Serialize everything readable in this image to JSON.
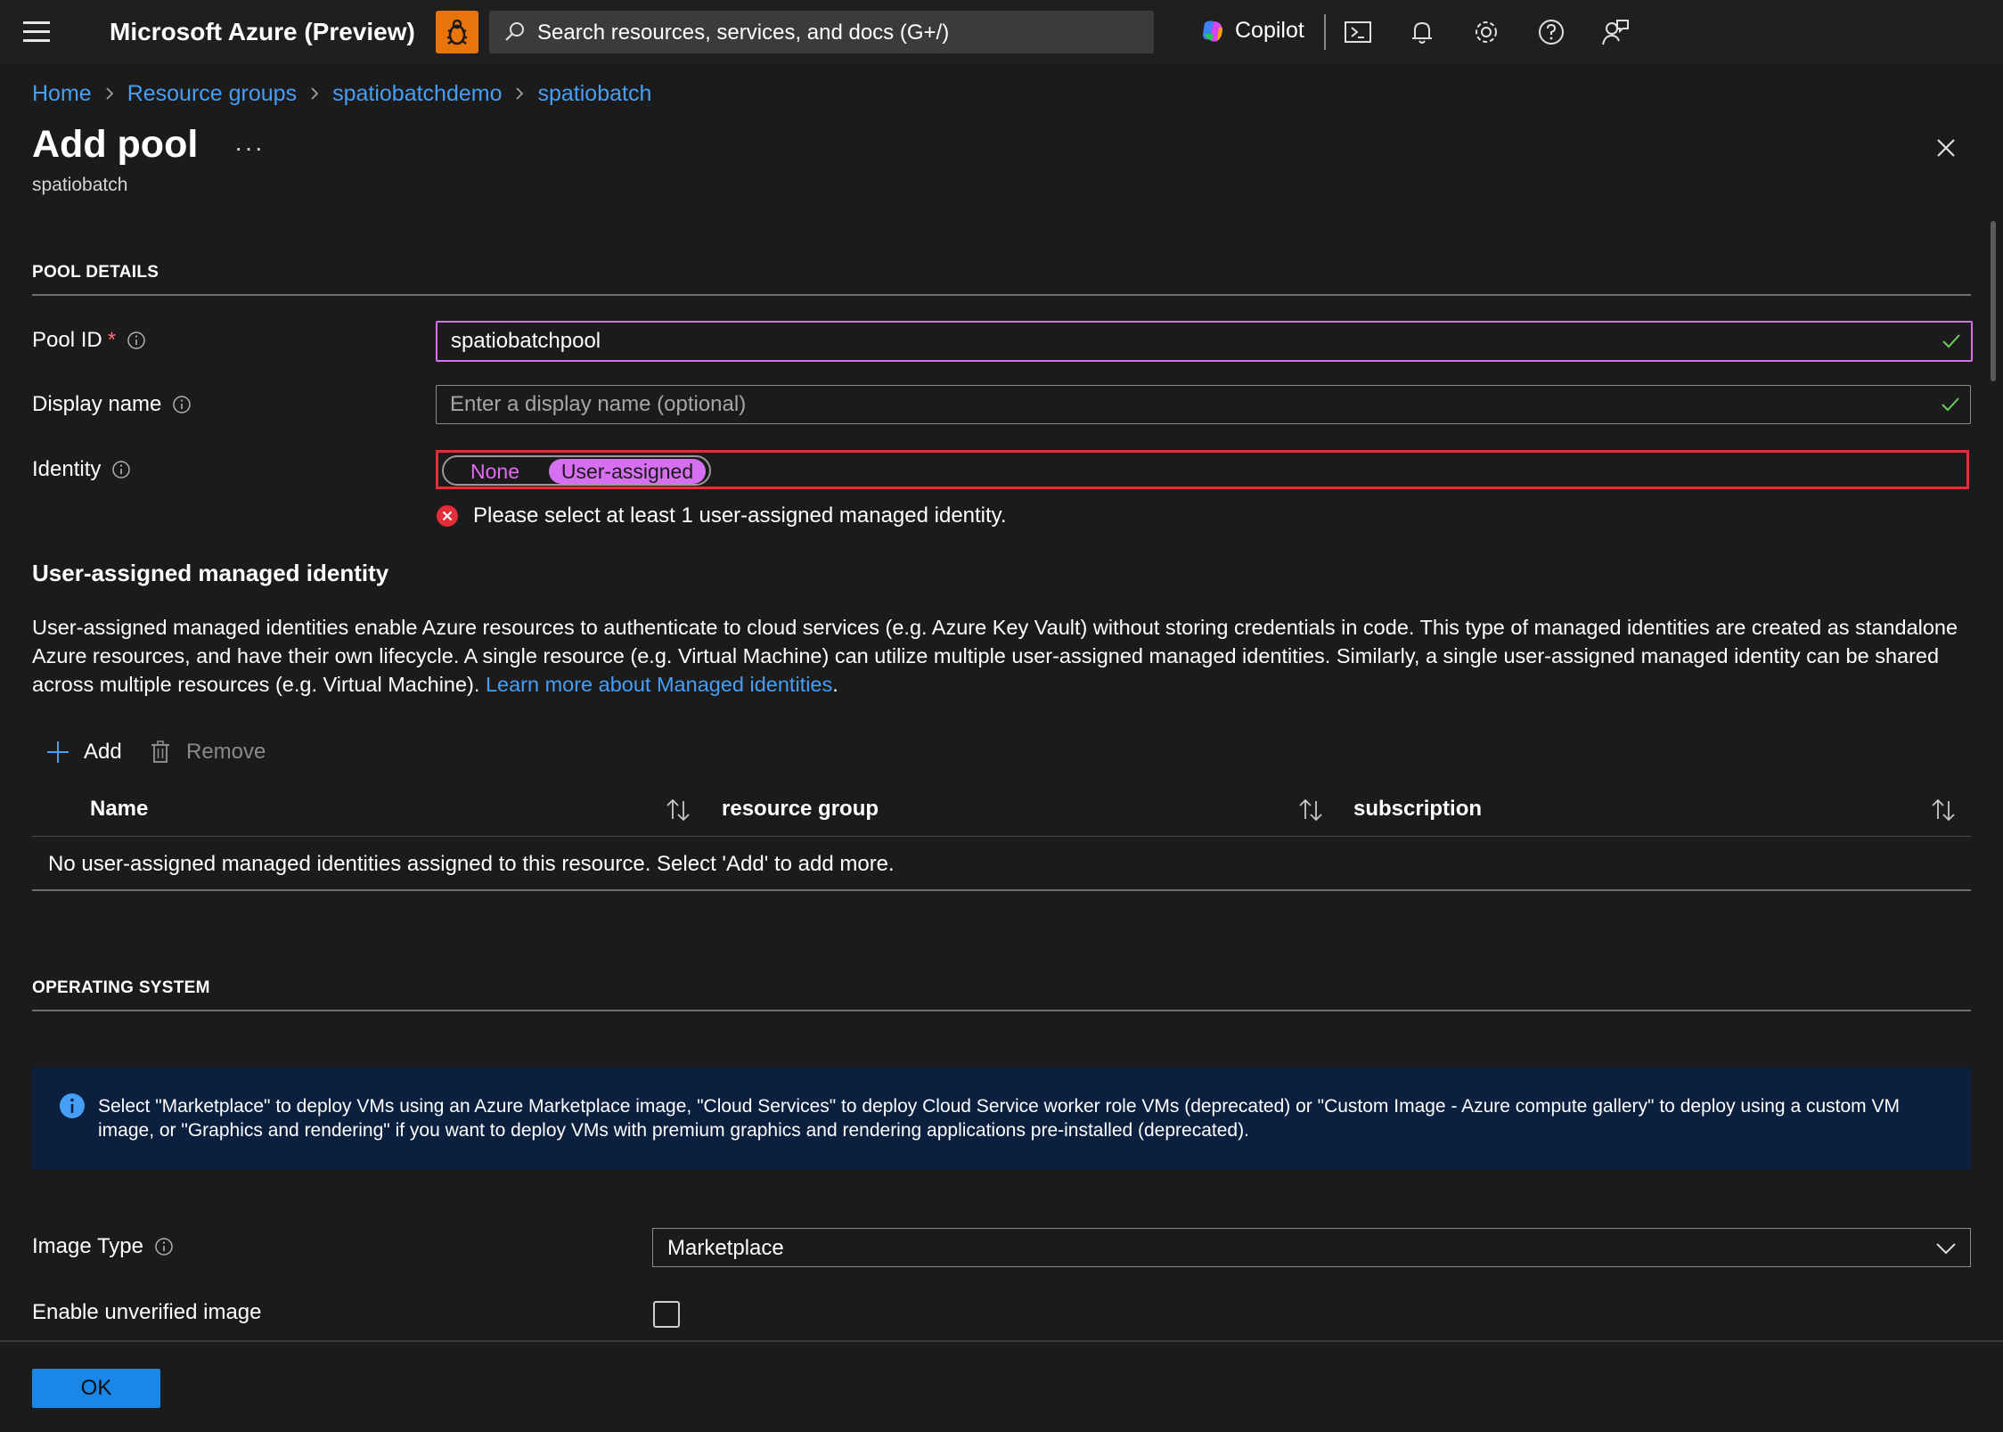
{
  "topbar": {
    "brand": "Microsoft Azure (Preview)",
    "search_placeholder": "Search resources, services, and docs (G+/)",
    "copilot_label": "Copilot"
  },
  "breadcrumb": [
    "Home",
    "Resource groups",
    "spatiobatchdemo",
    "spatiobatch"
  ],
  "header": {
    "title": "Add pool",
    "more": "···",
    "subtitle": "spatiobatch"
  },
  "pool_details": {
    "section_title": "POOL DETAILS",
    "pool_id_label": "Pool ID",
    "pool_id_required": "*",
    "pool_id_value": "spatiobatchpool",
    "display_name_label": "Display name",
    "display_name_placeholder": "Enter a display name (optional)",
    "identity_label": "Identity",
    "identity_options": [
      "None",
      "User-assigned"
    ],
    "identity_selected": "User-assigned",
    "identity_error": "Please select at least 1 user-assigned managed identity."
  },
  "managed_identity": {
    "title": "User-assigned managed identity",
    "description": "User-assigned managed identities enable Azure resources to authenticate to cloud services (e.g. Azure Key Vault) without storing credentials in code. This type of managed identities are created as standalone Azure resources, and have their own lifecycle. A single resource (e.g. Virtual Machine) can utilize multiple user-assigned managed identities. Similarly, a single user-assigned managed identity can be shared across multiple resources (e.g. Virtual Machine). ",
    "learn_more": "Learn more about Managed identities",
    "period": ".",
    "add_label": "Add",
    "remove_label": "Remove",
    "columns": [
      "Name",
      "resource group",
      "subscription"
    ],
    "empty_message": "No user-assigned managed identities assigned to this resource. Select 'Add' to add more."
  },
  "operating_system": {
    "section_title": "OPERATING SYSTEM",
    "info": "Select \"Marketplace\" to deploy VMs using an Azure Marketplace image, \"Cloud Services\" to deploy Cloud Service worker role VMs (deprecated) or \"Custom Image - Azure compute gallery\" to deploy using a custom VM image, or \"Graphics and rendering\" if you want to deploy VMs with premium graphics and rendering applications pre-installed (deprecated).",
    "image_type_label": "Image Type",
    "image_type_value": "Marketplace",
    "unverified_label": "Enable unverified image",
    "unverified_checked": false
  },
  "footer": {
    "ok_label": "OK"
  },
  "colors": {
    "accent": "#479ef5",
    "selection": "#d670f0",
    "error": "#e32d39",
    "primary_button": "#1a87e8",
    "info_background": "#0b1f3f"
  }
}
